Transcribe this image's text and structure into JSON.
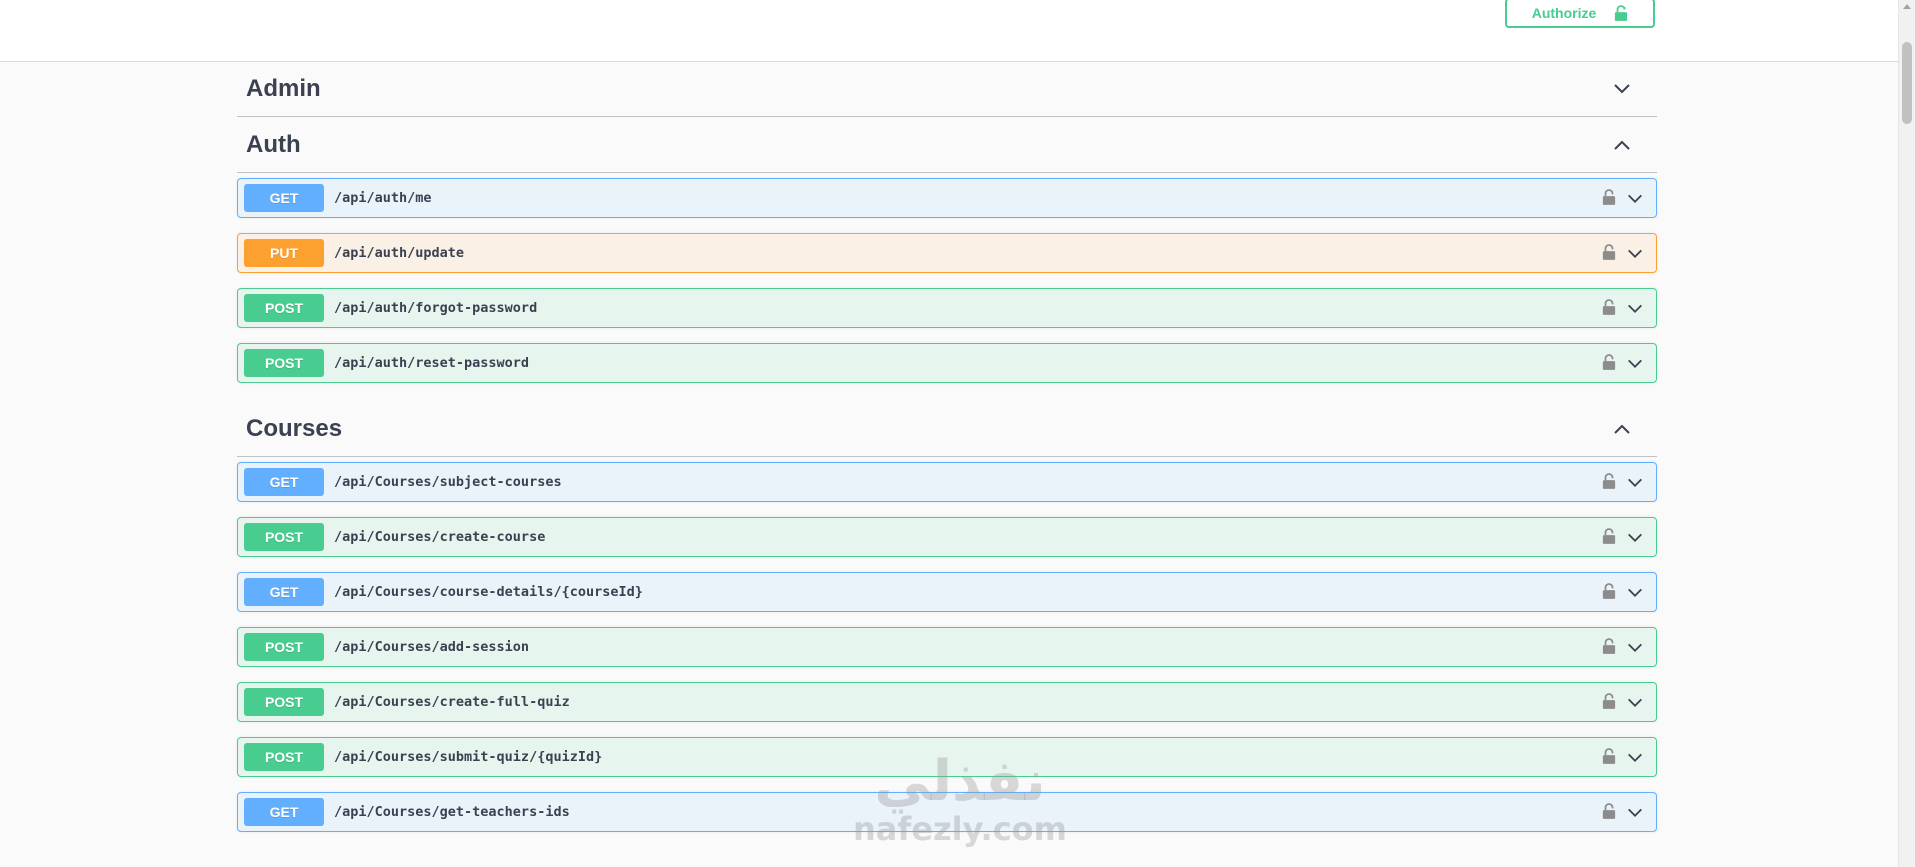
{
  "topbar": {
    "authorize_label": "Authorize",
    "authorize_icon": "unlock-icon",
    "accent_color": "#49cc90"
  },
  "sections": {
    "admin": {
      "name": "Admin",
      "expanded": false
    },
    "auth": {
      "name": "Auth",
      "expanded": true,
      "operations": [
        {
          "method": "GET",
          "path": "/api/auth/me"
        },
        {
          "method": "PUT",
          "path": "/api/auth/update"
        },
        {
          "method": "POST",
          "path": "/api/auth/forgot-password"
        },
        {
          "method": "POST",
          "path": "/api/auth/reset-password"
        }
      ]
    },
    "courses": {
      "name": "Courses",
      "expanded": true,
      "operations": [
        {
          "method": "GET",
          "path": "/api/Courses/subject-courses"
        },
        {
          "method": "POST",
          "path": "/api/Courses/create-course"
        },
        {
          "method": "GET",
          "path": "/api/Courses/course-details/{courseId}"
        },
        {
          "method": "POST",
          "path": "/api/Courses/add-session"
        },
        {
          "method": "POST",
          "path": "/api/Courses/create-full-quiz"
        },
        {
          "method": "POST",
          "path": "/api/Courses/submit-quiz/{quizId}"
        },
        {
          "method": "GET",
          "path": "/api/Courses/get-teachers-ids"
        }
      ]
    }
  },
  "method_colors": {
    "GET": "#61affe",
    "PUT": "#fca130",
    "POST": "#49cc90"
  },
  "watermark": {
    "arabic": "نفذلي",
    "latin": "nafezly.com"
  }
}
